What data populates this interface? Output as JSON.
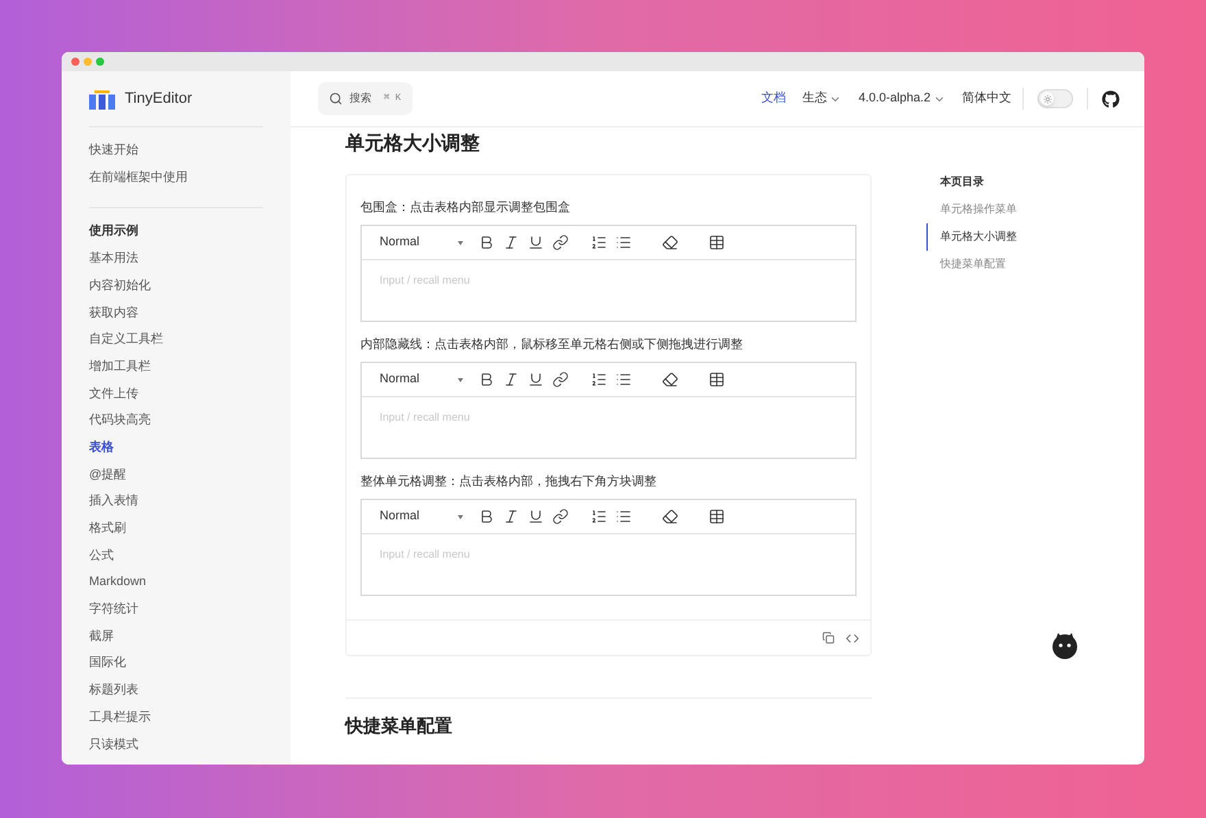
{
  "sidebar": {
    "logo_text": "TinyEditor",
    "groups": [
      {
        "items": [
          {
            "label": "快速开始",
            "selected": false
          },
          {
            "label": "在前端框架中使用",
            "selected": false
          }
        ]
      },
      {
        "title": "使用示例",
        "items": [
          {
            "label": "基本用法",
            "selected": false
          },
          {
            "label": "内容初始化",
            "selected": false
          },
          {
            "label": "获取内容",
            "selected": false
          },
          {
            "label": "自定义工具栏",
            "selected": false
          },
          {
            "label": "增加工具栏",
            "selected": false
          },
          {
            "label": "文件上传",
            "selected": false
          },
          {
            "label": "代码块高亮",
            "selected": false
          },
          {
            "label": "表格",
            "selected": true
          },
          {
            "label": "@提醒",
            "selected": false
          },
          {
            "label": "插入表情",
            "selected": false
          },
          {
            "label": "格式刷",
            "selected": false
          },
          {
            "label": "公式",
            "selected": false
          },
          {
            "label": "Markdown",
            "selected": false
          },
          {
            "label": "字符统计",
            "selected": false
          },
          {
            "label": "截屏",
            "selected": false
          },
          {
            "label": "国际化",
            "selected": false
          },
          {
            "label": "标题列表",
            "selected": false
          },
          {
            "label": "工具栏提示",
            "selected": false
          },
          {
            "label": "只读模式",
            "selected": false
          }
        ]
      }
    ]
  },
  "top_nav": {
    "search": {
      "placeholder": "搜索",
      "shortcut": "⌘ K"
    },
    "items": [
      {
        "label": "文档",
        "selected": true,
        "dropdown": false
      },
      {
        "label": "生态",
        "selected": false,
        "dropdown": true
      },
      {
        "label": "4.0.0-alpha.2",
        "selected": false,
        "dropdown": true
      },
      {
        "label": "简体中文",
        "selected": false,
        "dropdown": false
      }
    ],
    "theme_toggle": {
      "on": false
    }
  },
  "content": {
    "heading": "单元格大小调整",
    "demos": [
      {
        "description": "包围盒：点击表格内部显示调整包围盒",
        "editor": {
          "format": "Normal",
          "placeholder": "Input / recall menu"
        }
      },
      {
        "description": "内部隐藏线：点击表格内部，鼠标移至单元格右侧或下侧拖拽进行调整",
        "editor": {
          "format": "Normal",
          "placeholder": "Input / recall menu"
        }
      },
      {
        "description": "整体单元格调整：点击表格内部，拖拽右下角方块调整",
        "editor": {
          "format": "Normal",
          "placeholder": "Input / recall menu"
        }
      }
    ],
    "next_heading": "快捷菜单配置"
  },
  "toc": {
    "title": "本页目录",
    "items": [
      {
        "label": "单元格操作菜单",
        "selected": false
      },
      {
        "label": "单元格大小调整",
        "selected": true
      },
      {
        "label": "快捷菜单配置",
        "selected": false
      }
    ]
  }
}
